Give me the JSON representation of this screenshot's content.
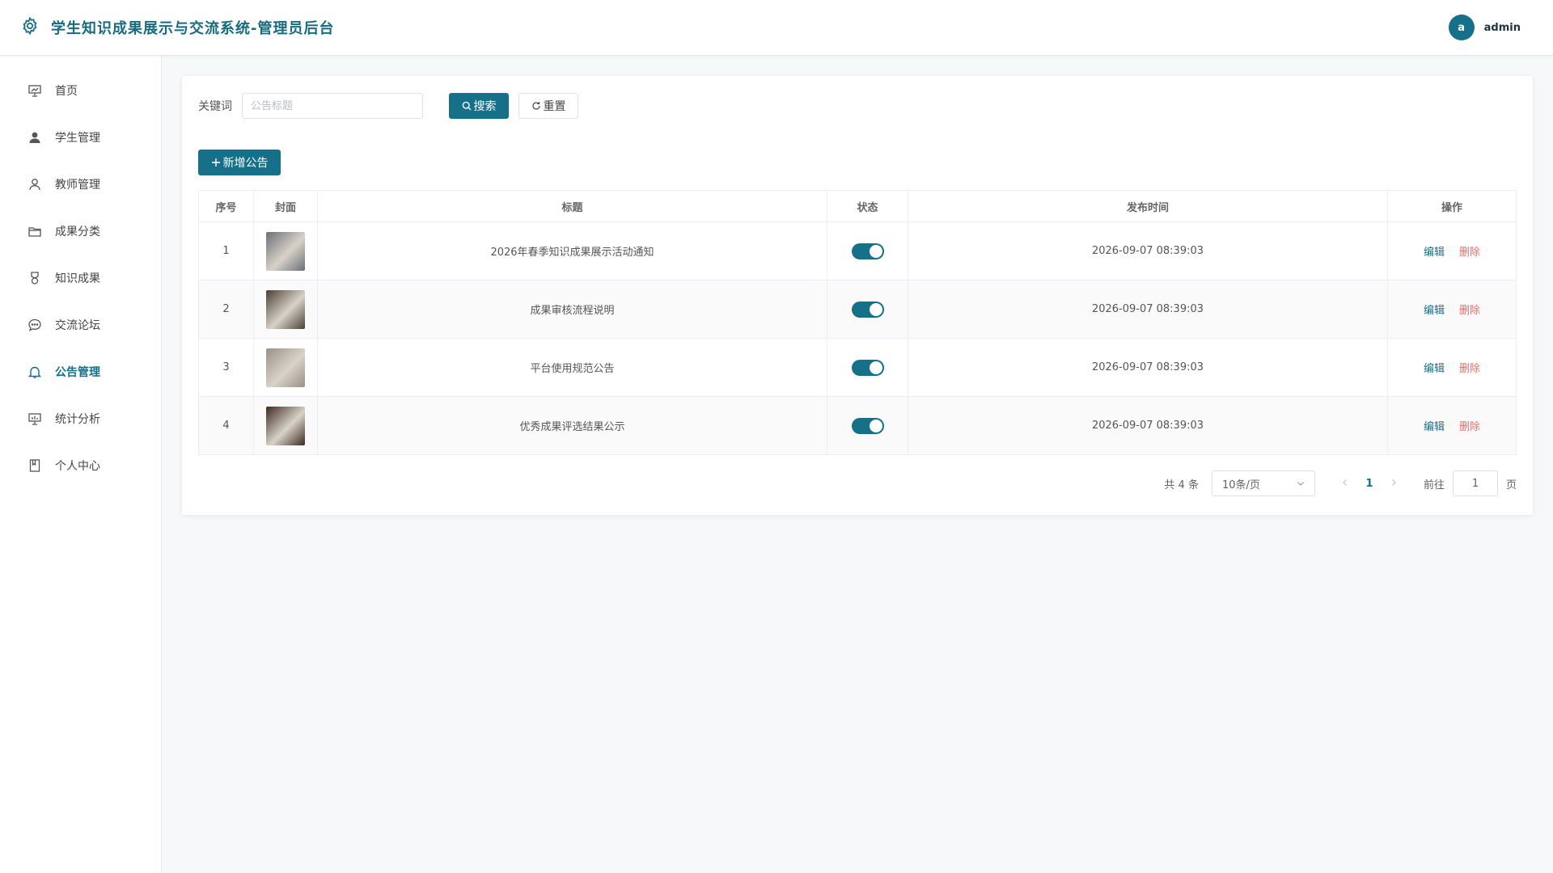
{
  "header": {
    "title": "学生知识成果展示与交流系统-管理员后台",
    "avatar_letter": "a",
    "username": "admin"
  },
  "sidebar": {
    "items": [
      {
        "label": "首页",
        "icon": "presentation-icon",
        "active": false
      },
      {
        "label": "学生管理",
        "icon": "user-filled-icon",
        "active": false
      },
      {
        "label": "教师管理",
        "icon": "user-outline-icon",
        "active": false
      },
      {
        "label": "成果分类",
        "icon": "folder-icon",
        "active": false
      },
      {
        "label": "知识成果",
        "icon": "medal-icon",
        "active": false
      },
      {
        "label": "交流论坛",
        "icon": "chat-bubble-icon",
        "active": false
      },
      {
        "label": "公告管理",
        "icon": "bell-icon",
        "active": true
      },
      {
        "label": "统计分析",
        "icon": "chart-board-icon",
        "active": false
      },
      {
        "label": "个人中心",
        "icon": "notebook-icon",
        "active": false
      }
    ]
  },
  "filter": {
    "label": "关键词",
    "placeholder": "公告标题",
    "value": "",
    "search_label": "搜索",
    "reset_label": "重置"
  },
  "toolbar": {
    "add_label": "新增公告"
  },
  "table": {
    "columns": [
      "序号",
      "封面",
      "标题",
      "状态",
      "发布时间",
      "操作"
    ],
    "rows": [
      {
        "index": "1",
        "title": "2026年春季知识成果展示活动通知",
        "status": true,
        "time": "2026-09-07 08:39:03",
        "edit": "编辑",
        "delete": "删除",
        "cover_color": "#6b6f78"
      },
      {
        "index": "2",
        "title": "成果审核流程说明",
        "status": true,
        "time": "2026-09-07 08:39:03",
        "edit": "编辑",
        "delete": "删除",
        "cover_color": "#4a3e34"
      },
      {
        "index": "3",
        "title": "平台使用规范公告",
        "status": true,
        "time": "2026-09-07 08:39:03",
        "edit": "编辑",
        "delete": "删除",
        "cover_color": "#9a9188"
      },
      {
        "index": "4",
        "title": "优秀成果评选结果公示",
        "status": true,
        "time": "2026-09-07 08:39:03",
        "edit": "编辑",
        "delete": "删除",
        "cover_color": "#3c2a20"
      }
    ]
  },
  "pagination": {
    "total_text": "共 4 条",
    "page_size": "10条/页",
    "current_page": "1",
    "goto_label": "前往",
    "goto_value": "1",
    "page_suffix": "页"
  },
  "colors": {
    "accent": "#16708a",
    "danger": "#f56c6c"
  }
}
